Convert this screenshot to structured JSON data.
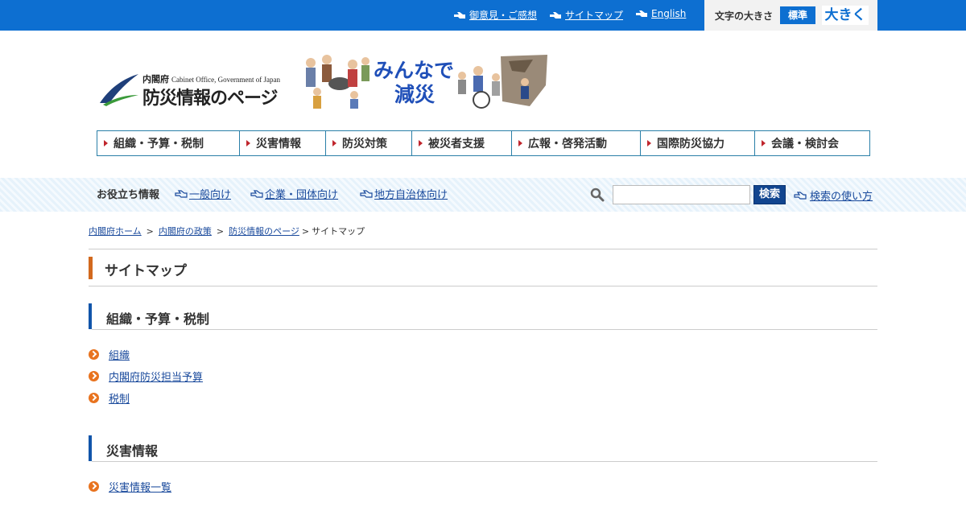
{
  "topbar": {
    "links": [
      "御意見・ご感想",
      "サイトマップ",
      "English"
    ],
    "fontsize_label": "文字の大きさ",
    "fontsize_normal": "標準",
    "fontsize_large": "大きく"
  },
  "logo": {
    "cabinet": "内閣府",
    "cabinet_en": "Cabinet Office, Government of Japan",
    "title": "防災情報のページ",
    "slogan_line1": "みんなで",
    "slogan_line2": "減災"
  },
  "gnav": [
    "組織・予算・税制",
    "災害情報",
    "防災対策",
    "被災者支援",
    "広報・啓発活動",
    "国際防災協力",
    "会議・検討会"
  ],
  "band": {
    "title": "お役立ち情報",
    "links": [
      "一般向け",
      "企業・団体向け",
      "地方自治体向け"
    ],
    "search_placeholder": "",
    "search_button": "検索",
    "howto": "検索の使い方"
  },
  "breadcrumb": {
    "items": [
      "内閣府ホーム",
      "内閣府の政策",
      "防災情報のページ"
    ],
    "separator": ">",
    "current": "サイトマップ"
  },
  "page_title": "サイトマップ",
  "sections": [
    {
      "title": "組織・予算・税制",
      "items": [
        "組織",
        "内閣府防災担当予算",
        "税制"
      ]
    },
    {
      "title": "災害情報",
      "items": [
        "災害情報一覧"
      ]
    }
  ],
  "colors": {
    "topbar": "#0d6fd1",
    "nav_border": "#2a7fa8",
    "section_bar": "#1155aa",
    "title_bar": "#d2691e",
    "bullet": "#e8731f",
    "link": "#1a4a9c"
  }
}
